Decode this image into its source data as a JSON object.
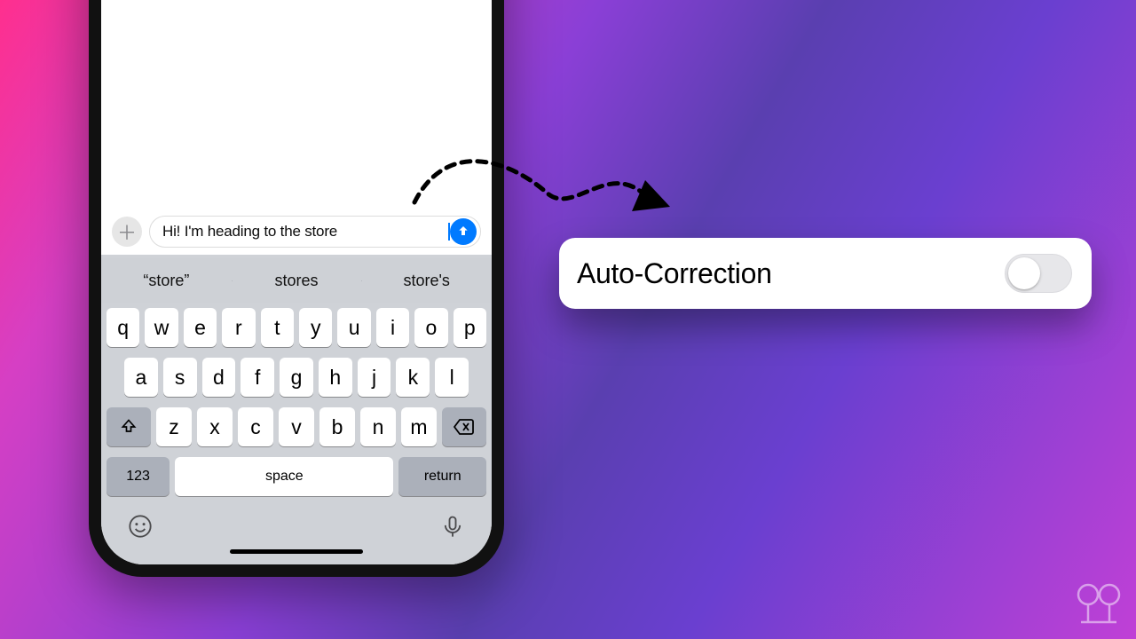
{
  "compose": {
    "text": "Hi! I'm heading to the store"
  },
  "suggestions": {
    "s0": "“store”",
    "s1": "stores",
    "s2": "store's"
  },
  "keyboard": {
    "row1": {
      "k0": "q",
      "k1": "w",
      "k2": "e",
      "k3": "r",
      "k4": "t",
      "k5": "y",
      "k6": "u",
      "k7": "i",
      "k8": "o",
      "k9": "p"
    },
    "row2": {
      "k0": "a",
      "k1": "s",
      "k2": "d",
      "k3": "f",
      "k4": "g",
      "k5": "h",
      "k6": "j",
      "k7": "k",
      "k8": "l"
    },
    "row3": {
      "k0": "z",
      "k1": "x",
      "k2": "c",
      "k3": "v",
      "k4": "b",
      "k5": "n",
      "k6": "m"
    },
    "numbers": "123",
    "space": "space",
    "ret": "return"
  },
  "settings": {
    "label": "Auto-Correction",
    "enabled": false
  }
}
